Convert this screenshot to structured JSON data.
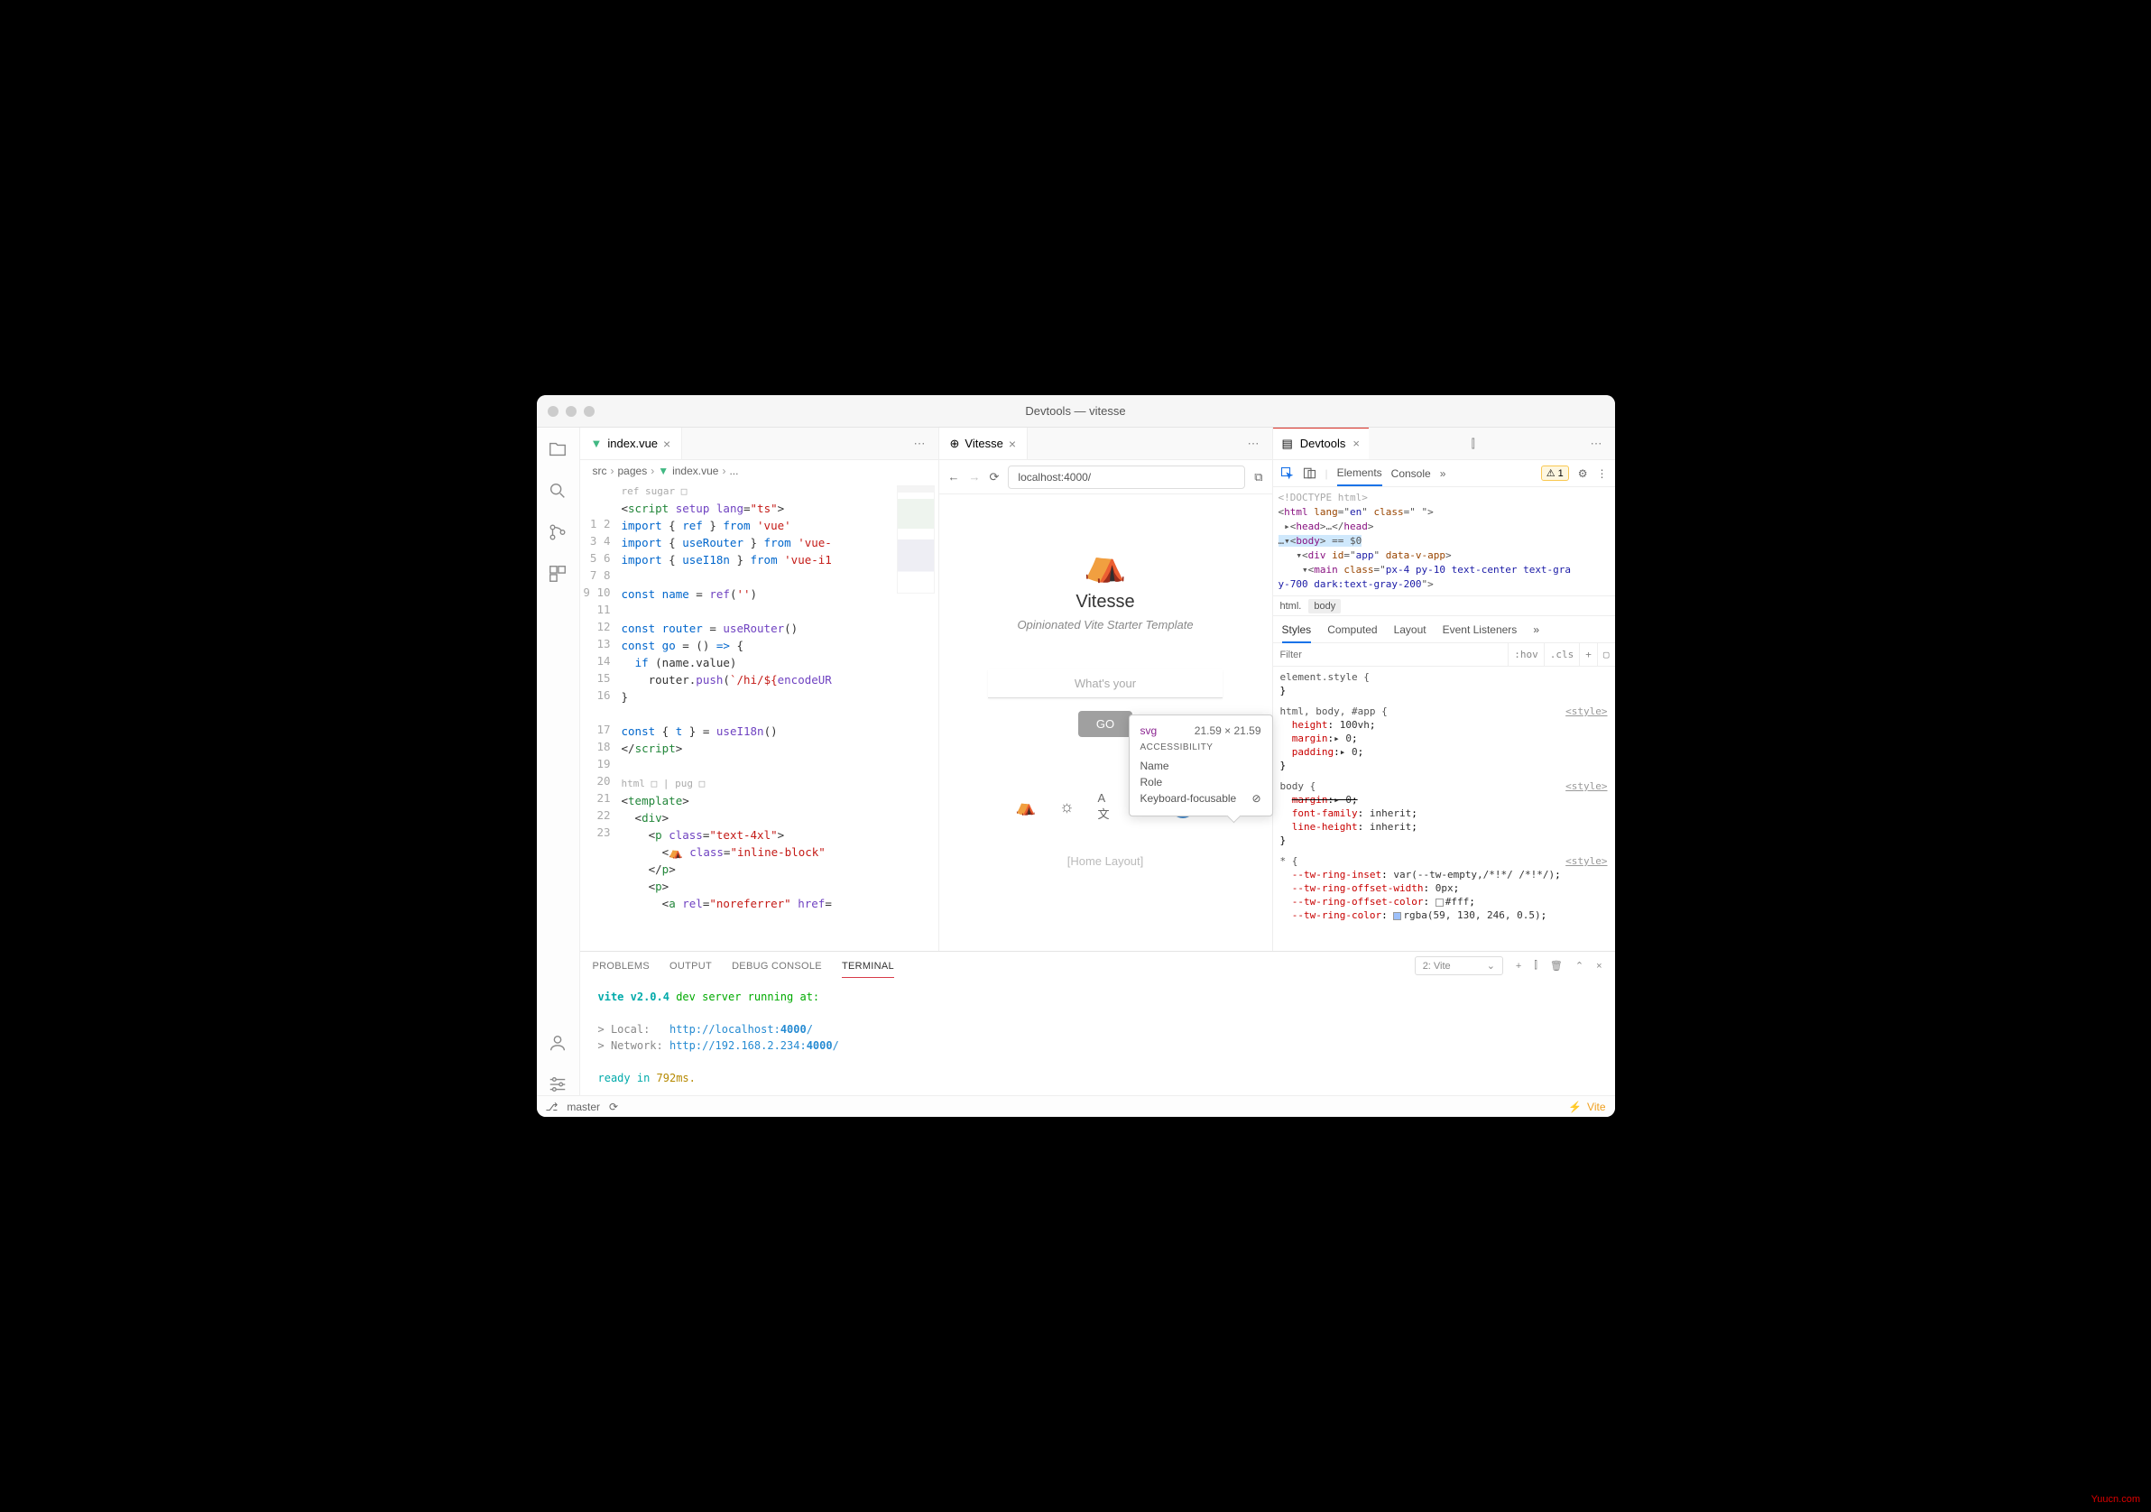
{
  "window": {
    "title": "Devtools — vitesse"
  },
  "tabs": {
    "editor": {
      "label": "index.vue"
    },
    "preview": {
      "label": "Vitesse"
    },
    "devtools": {
      "label": "Devtools"
    }
  },
  "breadcrumbs": [
    "src",
    "pages",
    "index.vue",
    "..."
  ],
  "code": {
    "hint1": "ref sugar □",
    "hint2": "html □ | pug □",
    "lines_count": 23
  },
  "browser": {
    "url": "localhost:4000/"
  },
  "preview": {
    "title": "Vitesse",
    "subtitle": "Opinionated Vite Starter Template",
    "placeholder": "What's your",
    "go": "GO",
    "layout": "[Home Layout]"
  },
  "tooltip": {
    "tag": "svg",
    "dims": "21.59 × 21.59",
    "section": "ACCESSIBILITY",
    "rows": {
      "name": "Name",
      "role": "Role",
      "kbd": "Keyboard-focusable"
    }
  },
  "devtools": {
    "panels": {
      "elements": "Elements",
      "console": "Console"
    },
    "warn_count": "1",
    "dom_doctype": "<!DOCTYPE html>",
    "bc": {
      "html": "html.",
      "body": "body"
    },
    "styles_tabs": {
      "styles": "Styles",
      "computed": "Computed",
      "layout": "Layout",
      "events": "Event Listeners"
    },
    "filter": {
      "placeholder": "Filter",
      "hov": ":hov",
      "cls": ".cls"
    },
    "rules": {
      "elstyle": "element.style {",
      "r1_sel": "html, body, #app {",
      "r1": {
        "p1": "height",
        "v1": "100vh",
        "p2": "margin",
        "v2": "▸ 0",
        "p3": "padding",
        "v3": "▸ 0"
      },
      "r2_sel": "body {",
      "r2": {
        "p1": "margin",
        "v1": "▸ 0",
        "p2": "font-family",
        "v2": "inherit",
        "p3": "line-height",
        "v3": "inherit"
      },
      "r3_sel": "* {",
      "r3": {
        "p1": "--tw-ring-inset",
        "v1": "var(--tw-empty,/*!*/ /*!*/)",
        "p2": "--tw-ring-offset-width",
        "v2": "0px",
        "p3": "--tw-ring-offset-color",
        "v3": "#fff",
        "p4": "--tw-ring-color",
        "v4": "rgba(59, 130, 246, 0.5)"
      },
      "src": "<style>"
    }
  },
  "bottom_panel": {
    "tabs": {
      "problems": "PROBLEMS",
      "output": "OUTPUT",
      "debug": "DEBUG CONSOLE",
      "terminal": "TERMINAL"
    },
    "term_select": "2: Vite",
    "terminal": {
      "l1a": "vite v2.0.4",
      "l1b": " dev server running at:",
      "l2a": "> Local:   ",
      "l2b": "http://localhost:",
      "l2c": "4000",
      "l2d": "/",
      "l3a": "> Network: ",
      "l3b": "http://192.168.2.234:",
      "l3c": "4000",
      "l3d": "/",
      "l4a": "ready in ",
      "l4b": "792ms."
    }
  },
  "statusbar": {
    "branch": "master",
    "vite": "Vite"
  },
  "watermark": "Yuucn.com"
}
